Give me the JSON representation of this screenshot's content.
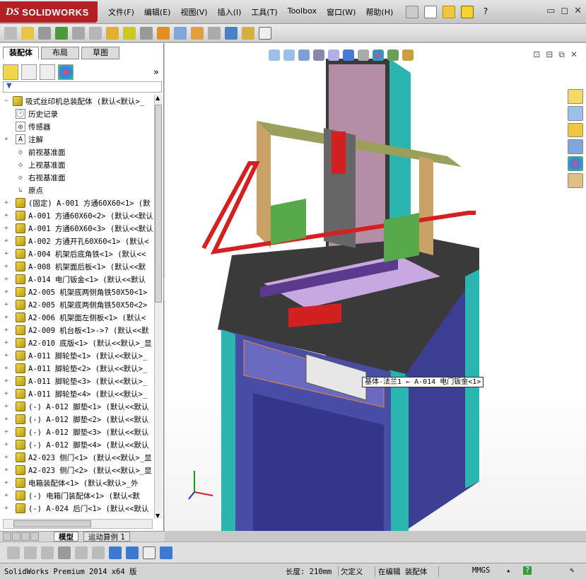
{
  "app": {
    "logo_prefix": "DS",
    "logo_name": "SOLIDWORKS"
  },
  "menu": [
    "文件(F)",
    "编辑(E)",
    "视图(V)",
    "插入(I)",
    "工具(T)",
    "Toolbox",
    "窗口(W)",
    "帮助(H)"
  ],
  "panel": {
    "tabs": [
      "装配体",
      "布局",
      "草图"
    ],
    "filter_icon": "filter-icon",
    "expand_arrows": "»"
  },
  "tree": [
    {
      "icon": "assembly",
      "text": "吸式丝印机总装配体  (默认<默认>_"
    },
    {
      "icon": "history",
      "text": "历史记录"
    },
    {
      "icon": "sensor",
      "text": "传感器"
    },
    {
      "icon": "annotation",
      "text": "注解"
    },
    {
      "icon": "plane",
      "text": "前视基准面"
    },
    {
      "icon": "plane",
      "text": "上视基准面"
    },
    {
      "icon": "plane",
      "text": "右视基准面"
    },
    {
      "icon": "origin",
      "text": "原点"
    },
    {
      "icon": "part",
      "text": "(固定) A-001 方通60X60<1> (默"
    },
    {
      "icon": "part",
      "text": "A-001 方通60X60<2> (默认<<默认"
    },
    {
      "icon": "part",
      "text": "A-001 方通60X60<3> (默认<<默认"
    },
    {
      "icon": "part",
      "text": "A-002 方通开孔60X60<1> (默认<"
    },
    {
      "icon": "part",
      "text": "A-004 机架后底角铁<1> (默认<<"
    },
    {
      "icon": "part",
      "text": "A-008 机架面后板<1> (默认<<默"
    },
    {
      "icon": "part",
      "text": "A-014 电门钣金<1> (默认<<默认"
    },
    {
      "icon": "part",
      "text": "A2-005 机架底两侧角铁50X50<1>"
    },
    {
      "icon": "part",
      "text": "A2-005 机架底两侧角铁50X50<2>"
    },
    {
      "icon": "part",
      "text": "A2-006 机架面左侧板<1> (默认<"
    },
    {
      "icon": "part",
      "text": "A2-009 机台板<1>->? (默认<<默"
    },
    {
      "icon": "part",
      "text": "A2-010 底版<1> (默认<<默认>_显"
    },
    {
      "icon": "part",
      "text": "A-011 脚轮垫<1> (默认<<默认>_"
    },
    {
      "icon": "part",
      "text": "A-011 脚轮垫<2> (默认<<默认>_"
    },
    {
      "icon": "part",
      "text": "A-011 脚轮垫<3> (默认<<默认>_"
    },
    {
      "icon": "part",
      "text": "A-011 脚轮垫<4> (默认<<默认>_"
    },
    {
      "icon": "part",
      "text": "(-) A-012 脚垫<1> (默认<<默认"
    },
    {
      "icon": "part",
      "text": "(-) A-012 脚垫<2> (默认<<默认"
    },
    {
      "icon": "part",
      "text": "(-) A-012 脚垫<3> (默认<<默认"
    },
    {
      "icon": "part",
      "text": "(-) A-012 脚垫<4> (默认<<默认"
    },
    {
      "icon": "part",
      "text": "A2-023 侧门<1> (默认<<默认>_显"
    },
    {
      "icon": "part",
      "text": "A2-023 侧门<2> (默认<<默认>_显"
    },
    {
      "icon": "assembly",
      "text": "电箱装配体<1> (默认<默认>_外"
    },
    {
      "icon": "assembly",
      "text": "(-) 电箱门装配体<1> (默认<默"
    },
    {
      "icon": "part",
      "text": "(-) A-024 后门<1> (默认<<默认"
    }
  ],
  "callout": "基体-法兰1 ← A-014 电门钣金<1>",
  "bottom_tabs": [
    "模型",
    "运动算例 1"
  ],
  "status": {
    "product": "SolidWorks Premium 2014 x64 版",
    "length": "长度: 210mm",
    "underdefined": "欠定义",
    "editing": "在编辑 装配体",
    "units": "MMGS",
    "help": "?"
  },
  "colors": {
    "logo_red": "#b21f24",
    "frame_teal": "#2bb5b0",
    "cabinet_blue": "#4a4da8",
    "rail_red": "#d42020",
    "platen_lilac": "#c8a8e0",
    "gantry_olive": "#9aa05a",
    "top_dark": "#3a3a3a"
  }
}
